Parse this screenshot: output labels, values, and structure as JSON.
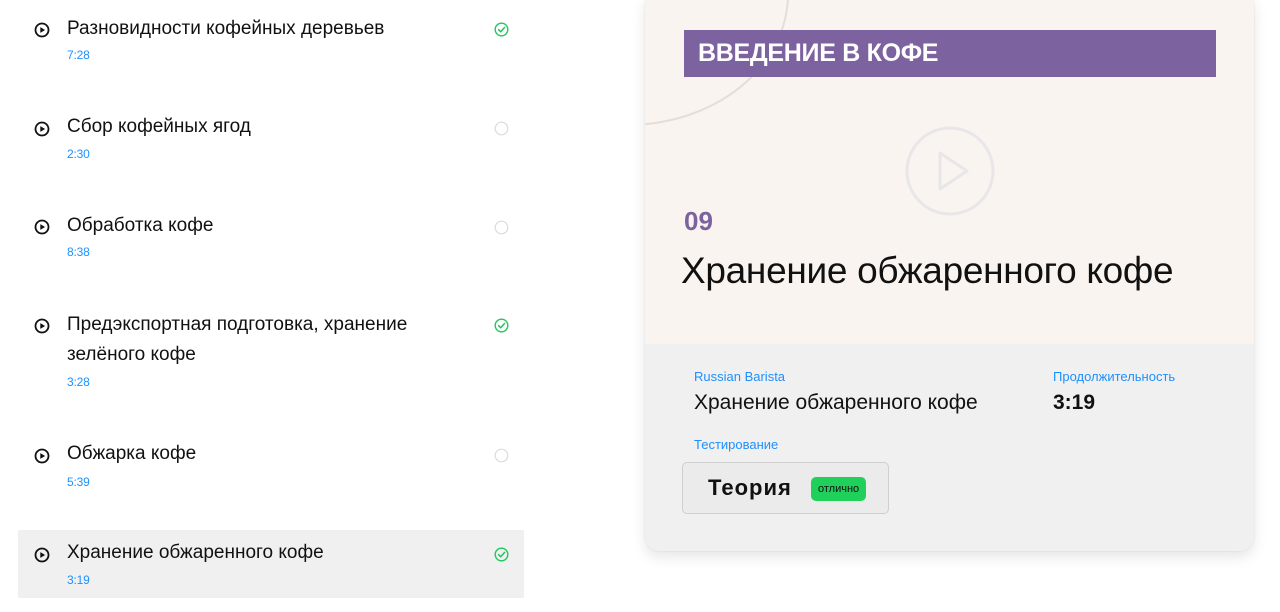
{
  "lessons": [
    {
      "title": "Разновидности кофейных деревьев",
      "duration": "7:28",
      "status": "completed",
      "status_icon": "check-circle-icon"
    },
    {
      "title": "Сбор кофейных ягод",
      "duration": "2:30",
      "status": "not-started",
      "status_icon": "empty-circle-icon"
    },
    {
      "title": "Обработка кофе",
      "duration": "8:38",
      "status": "not-started",
      "status_icon": "empty-circle-icon"
    },
    {
      "title": "Предэкспортная подготовка, хранение зелёного кофе",
      "duration": "3:28",
      "status": "completed",
      "status_icon": "check-circle-icon"
    },
    {
      "title": "Обжарка кофе",
      "duration": "5:39",
      "status": "not-started",
      "status_icon": "empty-circle-icon"
    },
    {
      "title": "Хранение обжаренного кофе",
      "duration": "3:19",
      "status": "completed",
      "status_icon": "check-circle-icon",
      "active": true
    }
  ],
  "card": {
    "banner": "ВВЕДЕНИЕ В КОФЕ",
    "number": "09",
    "cover_title": "Хранение обжаренного кофе",
    "author_label": "Russian Barista",
    "lesson_title": "Хранение обжаренного кофе",
    "duration_label": "Продолжительность",
    "duration_value": "3:19",
    "testing_label": "Тестирование",
    "test_name": "Теория",
    "grade": "отлично"
  },
  "colors": {
    "accent_purple": "#7d62a0",
    "link_blue": "#1e90ff",
    "success_green": "#1fd15b",
    "check_green": "#22c55e",
    "cover_bg": "#f9f4ef",
    "active_row_bg": "#f0f0f0"
  }
}
